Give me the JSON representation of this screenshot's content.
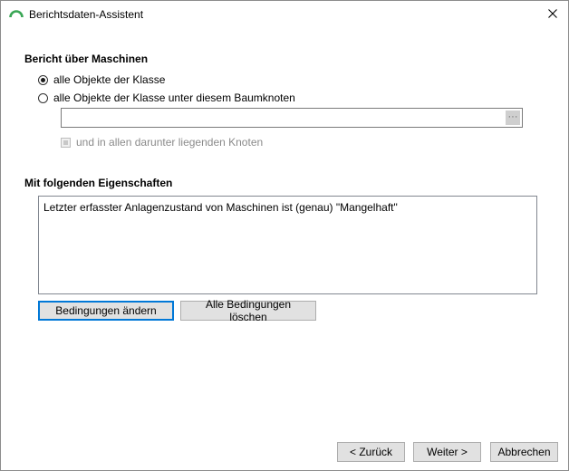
{
  "window": {
    "title": "Berichtsdaten-Assistent",
    "close_symbol": "✕",
    "accent_color": "#3aa655"
  },
  "scope": {
    "heading": "Bericht über Maschinen",
    "option_all": "alle Objekte der Klasse",
    "option_tree": "alle Objekte der Klasse unter diesem Baumknoten",
    "selected": "option_all",
    "node_value": "",
    "browse_label": "···",
    "include_subnodes_label": "und in allen darunter liegenden Knoten",
    "include_subnodes_checked": false
  },
  "properties": {
    "heading": "Mit folgenden Eigenschaften",
    "conditions": [
      "Letzter erfasster Anlagenzustand von Maschinen ist (genau) \"Mangelhaft\""
    ],
    "change_button": "Bedingungen ändern",
    "clear_button": "Alle Bedingungen löschen"
  },
  "footer": {
    "back_button": "< Zurück",
    "next_button": "Weiter >",
    "cancel_button": "Abbrechen"
  }
}
